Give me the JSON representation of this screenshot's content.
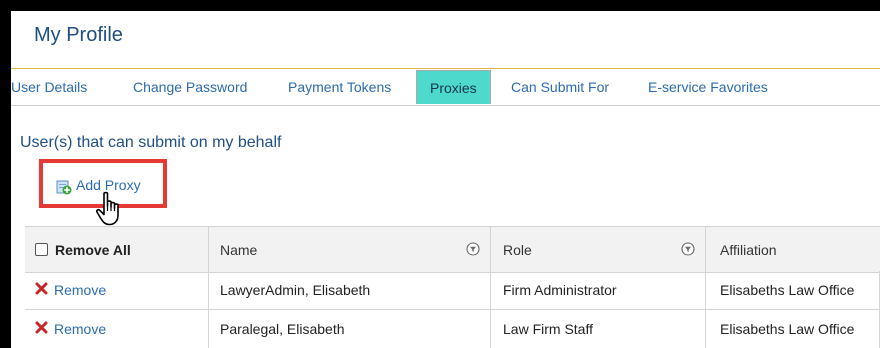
{
  "page": {
    "title": "My Profile"
  },
  "tabs": [
    {
      "label": "User Details",
      "active": false
    },
    {
      "label": "Change Password",
      "active": false
    },
    {
      "label": "Payment Tokens",
      "active": false
    },
    {
      "label": "Proxies",
      "active": true
    },
    {
      "label": "Can Submit For",
      "active": false
    },
    {
      "label": "E-service Favorites",
      "active": false
    }
  ],
  "section": {
    "title": "User(s) that can submit on my behalf",
    "add_proxy_label": "Add Proxy",
    "add_proxy_icon": "add-document-icon"
  },
  "table": {
    "remove_all_label": "Remove All",
    "columns": [
      "Name",
      "Role",
      "Affiliation"
    ],
    "rows": [
      {
        "action": "Remove",
        "name": "LawyerAdmin, Elisabeth",
        "role": "Firm Administrator",
        "affiliation": "Elisabeths Law Office"
      },
      {
        "action": "Remove",
        "name": "Paralegal, Elisabeth",
        "role": "Law Firm Staff",
        "affiliation": "Elisabeths Law Office"
      }
    ]
  },
  "colors": {
    "active_tab": "#4dd9cb",
    "highlight_box": "#e53935",
    "link": "#2b6cb0",
    "title": "#1f4f82"
  }
}
